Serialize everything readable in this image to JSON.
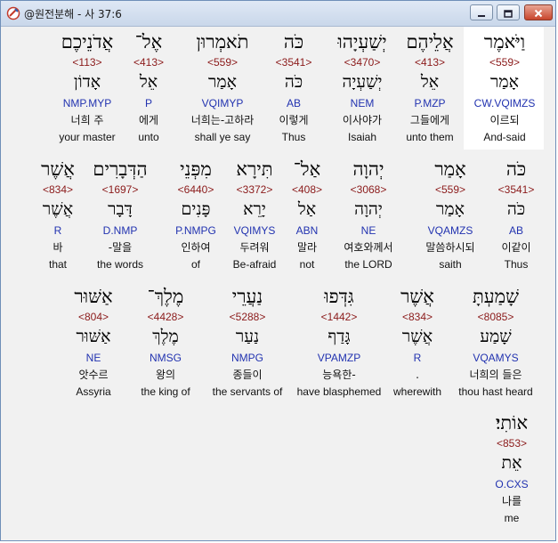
{
  "window": {
    "title": "@원전분해 - 사 37:6"
  },
  "rows": [
    {
      "words": [
        {
          "hebrew": "וַיֹּאמֶר",
          "strong": "<559>",
          "root": "אָמַר",
          "morph": "CW.VQIMZS",
          "korean": "이르되",
          "english": "And-said"
        },
        {
          "hebrew": "אֲלֵיהֶם",
          "strong": "<413>",
          "root": "אֵל",
          "morph": "P.MZP",
          "korean": "그들에게",
          "english": "unto them"
        },
        {
          "hebrew": "יְשַׁעְיָהוּ",
          "strong": "<3470>",
          "root": "יְשַׁעְיָה",
          "morph": "NEM",
          "korean": "이사야가",
          "english": "Isaiah"
        },
        {
          "hebrew": "כֹּה",
          "strong": "<3541>",
          "root": "כֹּה",
          "morph": "AB",
          "korean": "이렇게",
          "english": "Thus"
        },
        {
          "hebrew": "תֹאמְרוּן",
          "strong": "<559>",
          "root": "אָמַר",
          "morph": "VQIMYP",
          "korean": "너희는-고하라",
          "english": "shall ye say"
        },
        {
          "hebrew": "אֶל־",
          "strong": "<413>",
          "root": "אֵל",
          "morph": "P",
          "korean": "에게",
          "english": "unto"
        },
        {
          "hebrew": "אֲדֹנֵיכֶם",
          "strong": "<113>",
          "root": "אָדוֹן",
          "morph": "NMP.MYP",
          "korean": "너희 주",
          "english": "your master"
        }
      ]
    },
    {
      "words": [
        {
          "hebrew": "כֹּה",
          "strong": "<3541>",
          "root": "כֹּה",
          "morph": "AB",
          "korean": "이같이",
          "english": "Thus"
        },
        {
          "hebrew": "אָמַר",
          "strong": "<559>",
          "root": "אָמַר",
          "morph": "VQAMZS",
          "korean": "말씀하시되",
          "english": "saith"
        },
        {
          "hebrew": "יְהוָה",
          "strong": "<3068>",
          "root": "יְהוָה",
          "morph": "NE",
          "korean": "여호와께서",
          "english": "the LORD"
        },
        {
          "hebrew": "אַל־",
          "strong": "<408>",
          "root": "אַל",
          "morph": "ABN",
          "korean": "말라",
          "english": "not"
        },
        {
          "hebrew": "תִּירָא",
          "strong": "<3372>",
          "root": "יָרֵא",
          "morph": "VQIMYS",
          "korean": "두려워",
          "english": "Be-afraid"
        },
        {
          "hebrew": "מִפְּנֵי",
          "strong": "<6440>",
          "root": "פָּנִים",
          "morph": "P.NMPG",
          "korean": "인하여",
          "english": "of"
        },
        {
          "hebrew": "הַדְּבָרִים",
          "strong": "<1697>",
          "root": "דָּבָר",
          "morph": "D.NMP",
          "korean": "-말을",
          "english": "the words"
        },
        {
          "hebrew": "אֲשֶׁר",
          "strong": "<834>",
          "root": "אֲשֶׁר",
          "morph": "R",
          "korean": "바",
          "english": "that"
        }
      ]
    },
    {
      "words": [
        {
          "hebrew": "שָׁמַעְתָּ",
          "strong": "<8085>",
          "root": "שָׁמַע",
          "morph": "VQAMYS",
          "korean": "너희의 들은",
          "english": "thou hast heard"
        },
        {
          "hebrew": "אֲשֶׁר",
          "strong": "<834>",
          "root": "אֲשֶׁר",
          "morph": "R",
          "korean": ".",
          "english": "wherewith"
        },
        {
          "hebrew": "גִּדְּפוּ",
          "strong": "<1442>",
          "root": "גָּדַף",
          "morph": "VPAMZP",
          "korean": "능욕한-",
          "english": "have blasphemed"
        },
        {
          "hebrew": "נַעֲרֵי",
          "strong": "<5288>",
          "root": "נַעַר",
          "morph": "NMPG",
          "korean": "종들이",
          "english": "the servants of"
        },
        {
          "hebrew": "מֶלֶךְ־",
          "strong": "<4428>",
          "root": "מֶלֶךְ",
          "morph": "NMSG",
          "korean": "왕의",
          "english": "the king of"
        },
        {
          "hebrew": "אַשּׁוּר",
          "strong": "<804>",
          "root": "אַשּׁוּר",
          "morph": "NE",
          "korean": "앗수르",
          "english": "Assyria"
        }
      ]
    },
    {
      "words": [
        {
          "hebrew": "אוֹתִי׃",
          "strong": "<853>",
          "root": "אֵת",
          "morph": "O.CXS",
          "korean": "나를",
          "english": "me"
        }
      ]
    }
  ]
}
